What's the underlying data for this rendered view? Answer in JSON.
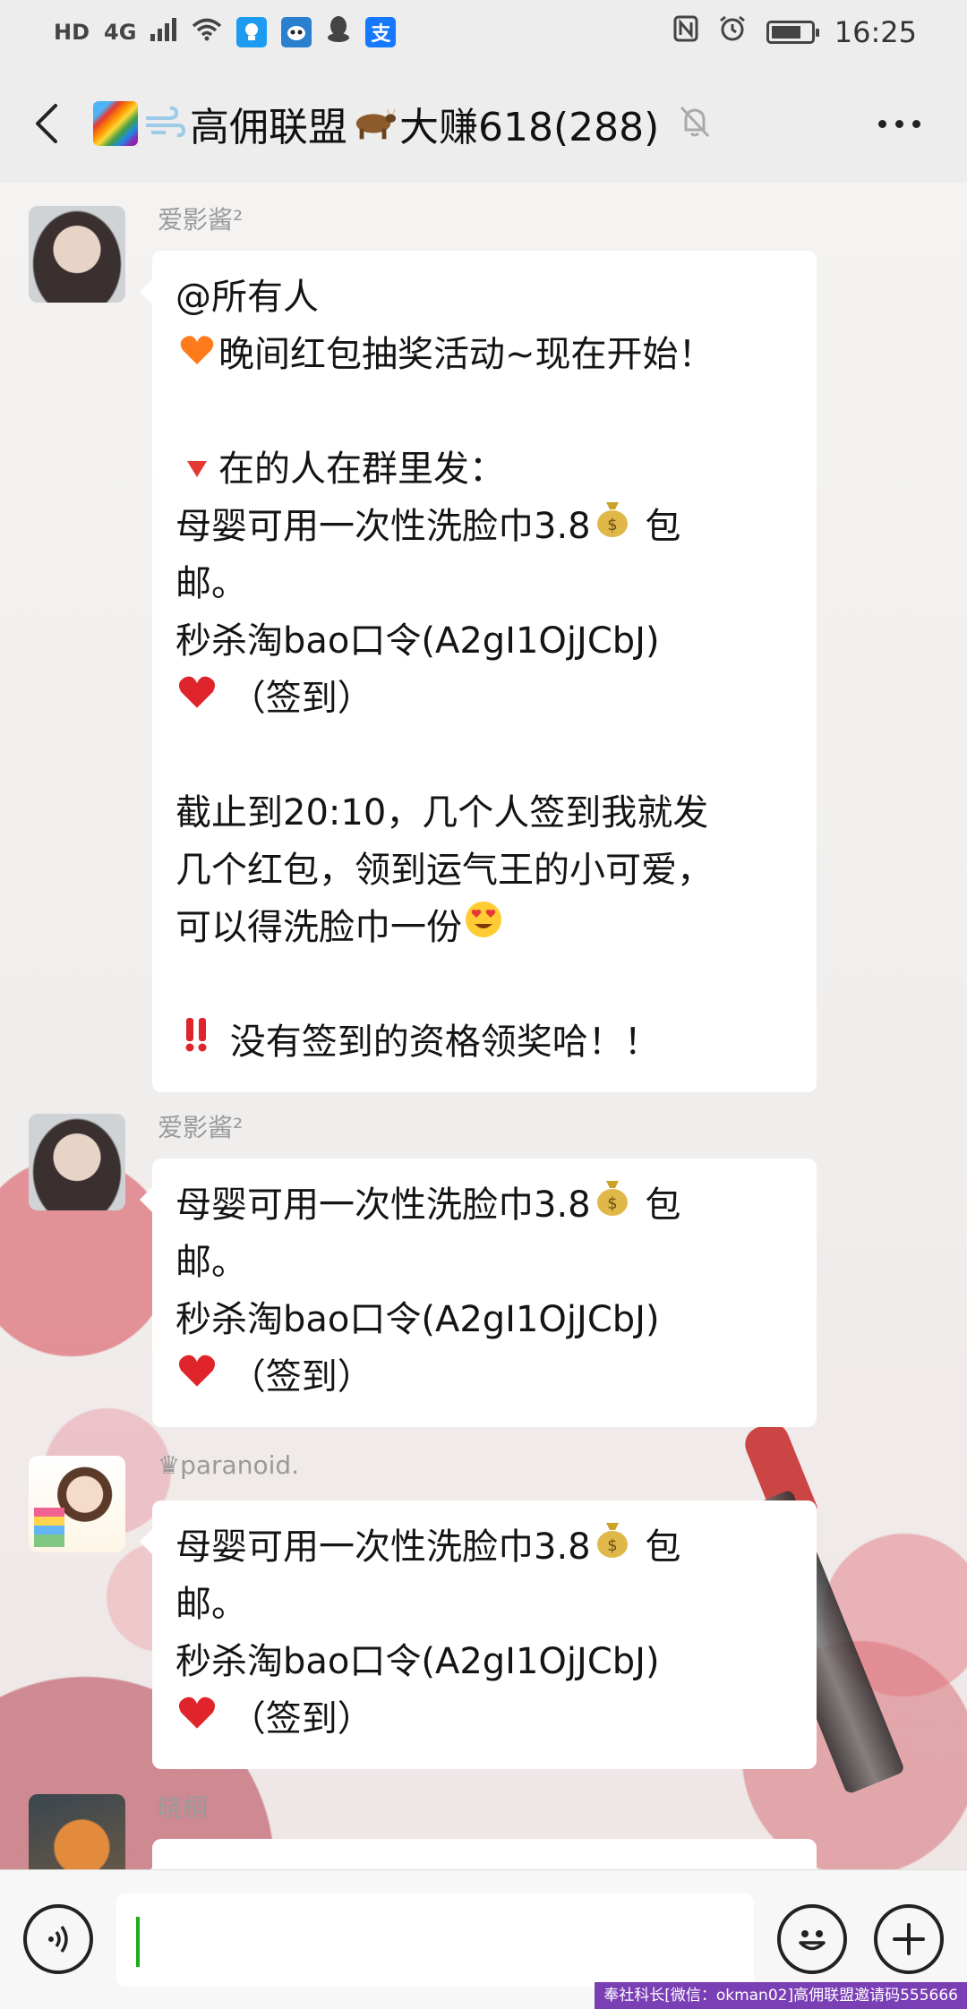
{
  "status_bar": {
    "left": [
      "HD",
      "4G"
    ],
    "alipay_icon_label": "支",
    "time": "16:25",
    "battery_level": 0.75
  },
  "header": {
    "title": "高佣联盟",
    "title_tail": "大赚618(288)",
    "back_icon": "chevron-left-icon",
    "mute_icon": "bell-off-icon",
    "more_icon": "more-dots-icon"
  },
  "messages": [
    {
      "sender": "爱影酱²",
      "lines": [
        "@所有人",
        "晚间红包抽奖活动~现在开始！",
        "",
        "在的人在群里发：",
        "母婴可用一次性洗脸巾3.8",
        "邮。",
        "秒杀淘bao口令(A2gI1OjJCbJ)",
        "（签到）",
        "",
        "截止到20:10，几个人签到我就发",
        "几个红包，领到运气王的小可爱，",
        "可以得洗脸巾一份",
        "",
        "没有签到的资格领奖哈！！"
      ],
      "suffix_bao": "包"
    },
    {
      "sender": "爱影酱²",
      "lines": [
        "母婴可用一次性洗脸巾3.8",
        "邮。",
        "秒杀淘bao口令(A2gI1OjJCbJ)",
        "（签到）"
      ],
      "suffix_bao": "包"
    },
    {
      "sender": "♛paranoid.",
      "lines": [
        "母婴可用一次性洗脸巾3.8",
        "邮。",
        "秒杀淘bao口令(A2gI1OjJCbJ)",
        "（签到）"
      ],
      "suffix_bao": "包"
    },
    {
      "sender": "晓桐",
      "lines": []
    }
  ],
  "input": {
    "value": "",
    "placeholder": ""
  },
  "watermark": "奉社科长[微信：okman02]高佣联盟邀请码555666",
  "colors": {
    "bubble": "#ffffff",
    "header_bg": "#ededed",
    "caret": "#1aad19",
    "sender": "#9a9a9a"
  }
}
